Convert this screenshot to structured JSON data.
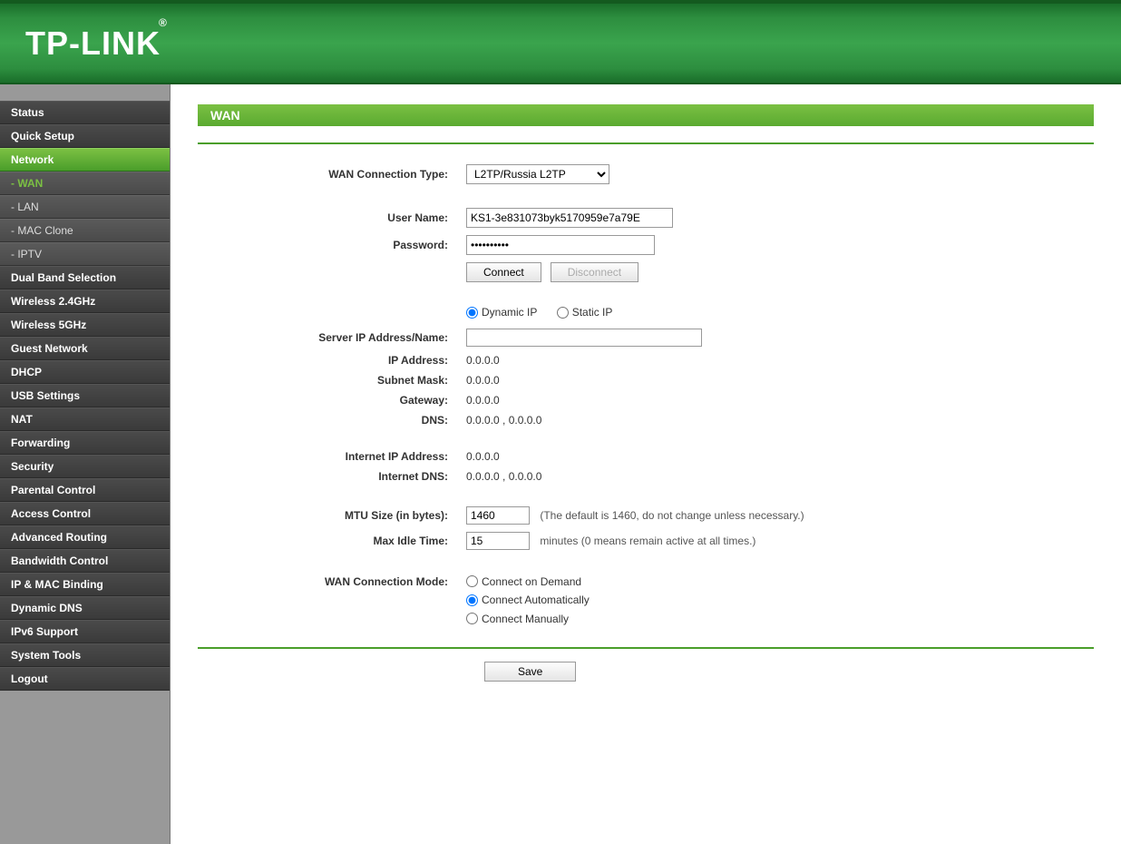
{
  "brand": "TP-LINK",
  "sidebar": {
    "items": [
      {
        "label": "Status",
        "type": "item",
        "active": false
      },
      {
        "label": "Quick Setup",
        "type": "item",
        "active": false
      },
      {
        "label": "Network",
        "type": "item",
        "active": true
      },
      {
        "label": "- WAN",
        "type": "sub",
        "active": true
      },
      {
        "label": "- LAN",
        "type": "sub",
        "active": false
      },
      {
        "label": "- MAC Clone",
        "type": "sub",
        "active": false
      },
      {
        "label": "- IPTV",
        "type": "sub",
        "active": false
      },
      {
        "label": "Dual Band Selection",
        "type": "item",
        "active": false
      },
      {
        "label": "Wireless 2.4GHz",
        "type": "item",
        "active": false
      },
      {
        "label": "Wireless 5GHz",
        "type": "item",
        "active": false
      },
      {
        "label": "Guest Network",
        "type": "item",
        "active": false
      },
      {
        "label": "DHCP",
        "type": "item",
        "active": false
      },
      {
        "label": "USB Settings",
        "type": "item",
        "active": false
      },
      {
        "label": "NAT",
        "type": "item",
        "active": false
      },
      {
        "label": "Forwarding",
        "type": "item",
        "active": false
      },
      {
        "label": "Security",
        "type": "item",
        "active": false
      },
      {
        "label": "Parental Control",
        "type": "item",
        "active": false
      },
      {
        "label": "Access Control",
        "type": "item",
        "active": false
      },
      {
        "label": "Advanced Routing",
        "type": "item",
        "active": false
      },
      {
        "label": "Bandwidth Control",
        "type": "item",
        "active": false
      },
      {
        "label": "IP & MAC Binding",
        "type": "item",
        "active": false
      },
      {
        "label": "Dynamic DNS",
        "type": "item",
        "active": false
      },
      {
        "label": "IPv6 Support",
        "type": "item",
        "active": false
      },
      {
        "label": "System Tools",
        "type": "item",
        "active": false
      },
      {
        "label": "Logout",
        "type": "item",
        "active": false
      }
    ]
  },
  "page": {
    "title": "WAN",
    "labels": {
      "conn_type": "WAN Connection Type:",
      "username": "User Name:",
      "password": "Password:",
      "server_ip": "Server IP Address/Name:",
      "ip_addr": "IP Address:",
      "subnet": "Subnet Mask:",
      "gateway": "Gateway:",
      "dns": "DNS:",
      "inet_ip": "Internet IP Address:",
      "inet_dns": "Internet DNS:",
      "mtu": "MTU Size (in bytes):",
      "max_idle": "Max Idle Time:",
      "conn_mode": "WAN Connection Mode:"
    },
    "values": {
      "conn_type_selected": "L2TP/Russia L2TP",
      "username": "KS1-3e831073byk5170959e7a79E",
      "password": "••••••••••",
      "server_ip": "",
      "ip_addr": "0.0.0.0",
      "subnet": "0.0.0.0",
      "gateway": "0.0.0.0",
      "dns": "0.0.0.0 , 0.0.0.0",
      "inet_ip": "0.0.0.0",
      "inet_dns": "0.0.0.0 , 0.0.0.0",
      "mtu": "1460",
      "max_idle": "15"
    },
    "hints": {
      "mtu": "(The default is 1460, do not change unless necessary.)",
      "max_idle": "minutes (0 means remain active at all times.)"
    },
    "radios": {
      "ip_mode": {
        "dynamic": "Dynamic IP",
        "static": "Static IP",
        "selected": "dynamic"
      },
      "conn_mode": {
        "demand": "Connect on Demand",
        "auto": "Connect Automatically",
        "manual": "Connect Manually",
        "selected": "auto"
      }
    },
    "buttons": {
      "connect": "Connect",
      "disconnect": "Disconnect",
      "save": "Save"
    }
  }
}
